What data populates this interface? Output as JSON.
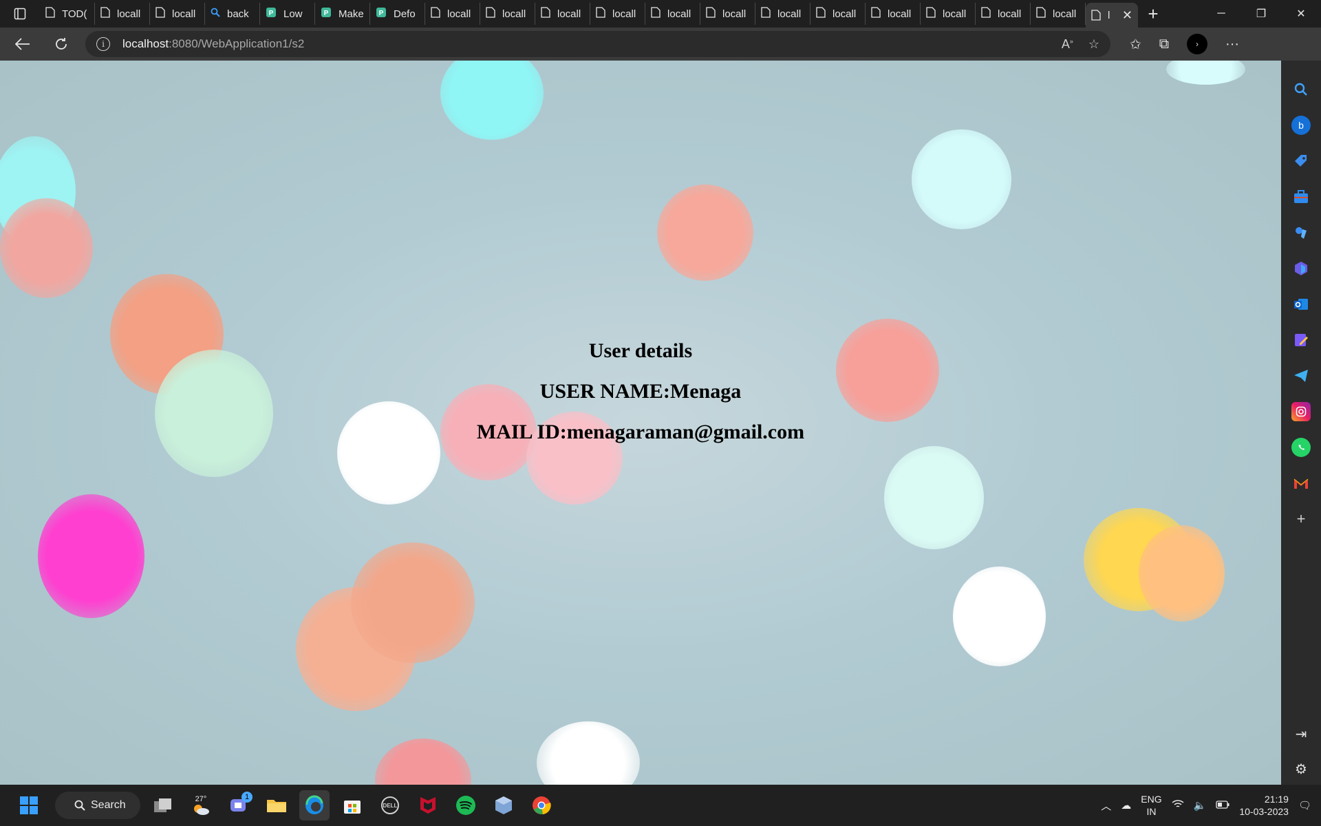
{
  "tabs": [
    {
      "label": "TOD(",
      "icon": "page-icon"
    },
    {
      "label": "locall",
      "icon": "page-icon"
    },
    {
      "label": "locall",
      "icon": "page-icon"
    },
    {
      "label": "back",
      "icon": "search-icon"
    },
    {
      "label": "Low",
      "icon": "app-icon"
    },
    {
      "label": "Make",
      "icon": "app-icon"
    },
    {
      "label": "Defo",
      "icon": "app-icon"
    },
    {
      "label": "locall",
      "icon": "page-icon"
    },
    {
      "label": "locall",
      "icon": "page-icon"
    },
    {
      "label": "locall",
      "icon": "page-icon"
    },
    {
      "label": "locall",
      "icon": "page-icon"
    },
    {
      "label": "locall",
      "icon": "page-icon"
    },
    {
      "label": "locall",
      "icon": "page-icon"
    },
    {
      "label": "locall",
      "icon": "page-icon"
    },
    {
      "label": "locall",
      "icon": "page-icon"
    },
    {
      "label": "locall",
      "icon": "page-icon"
    },
    {
      "label": "locall",
      "icon": "page-icon"
    },
    {
      "label": "locall",
      "icon": "page-icon"
    },
    {
      "label": "locall",
      "icon": "page-icon"
    }
  ],
  "active_tab": {
    "label": "l",
    "close": "✕"
  },
  "address": {
    "host": "localhost",
    "path": ":8080/WebApplication1/s2"
  },
  "page": {
    "heading": "User details",
    "user_name": "USER NAME:Menaga",
    "mail_id": "MAIL ID:menagaraman@gmail.com"
  },
  "taskbar": {
    "search_label": "Search",
    "weather_temp": "27°",
    "chat_badge": "1",
    "lang_line1": "ENG",
    "lang_line2": "IN",
    "time": "21:19",
    "date": "10-03-2023"
  },
  "colors": {
    "edge_blue": "#1e90ff",
    "spotify_green": "#1db954",
    "mcafee_red": "#c8102e"
  }
}
